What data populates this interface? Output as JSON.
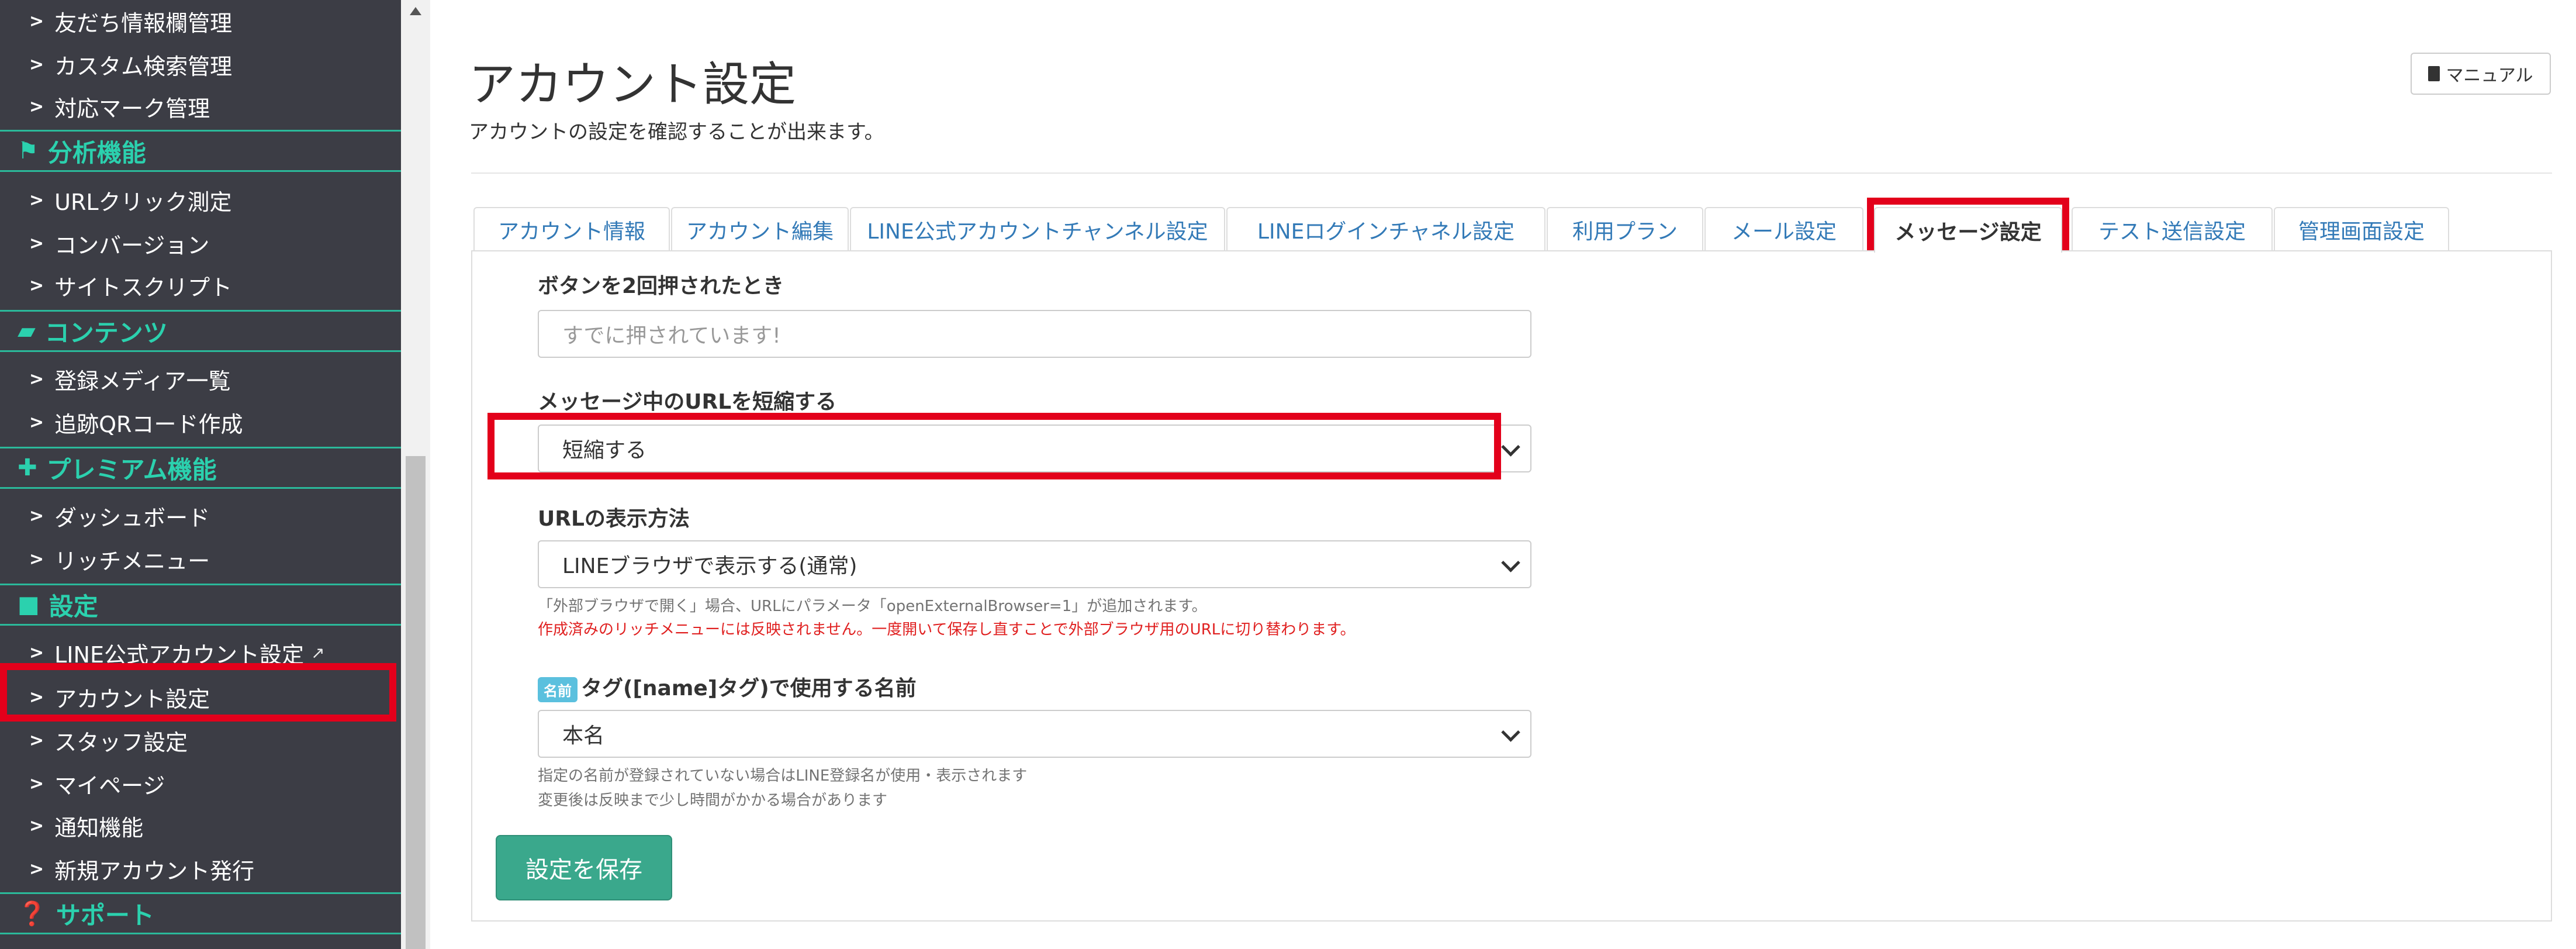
{
  "sidebar": {
    "items_top": [
      {
        "label": "友だち情報欄管理"
      },
      {
        "label": "カスタム検索管理"
      },
      {
        "label": "対応マーク管理"
      }
    ],
    "sections": [
      {
        "title": "分析機能",
        "icon": "flag-icon",
        "items": [
          {
            "label": "URLクリック測定"
          },
          {
            "label": "コンバージョン"
          },
          {
            "label": "サイトスクリプト"
          }
        ]
      },
      {
        "title": "コンテンツ",
        "icon": "folder-icon",
        "items": [
          {
            "label": "登録メディア一覧"
          },
          {
            "label": "追跡QRコード作成"
          }
        ]
      },
      {
        "title": "プレミアム機能",
        "icon": "gift-icon",
        "items": [
          {
            "label": "ダッシュボード"
          },
          {
            "label": "リッチメニュー"
          }
        ]
      },
      {
        "title": "設定",
        "icon": "comment-icon",
        "items": [
          {
            "label": "LINE公式アカウント設定"
          },
          {
            "label": "アカウント設定"
          },
          {
            "label": "スタッフ設定"
          },
          {
            "label": "マイページ"
          },
          {
            "label": "通知機能"
          },
          {
            "label": "新規アカウント発行"
          }
        ]
      },
      {
        "title": "サポート",
        "icon": "question-icon",
        "items": []
      }
    ]
  },
  "header": {
    "title": "アカウント設定",
    "description": "アカウントの設定を確認することが出来ます。",
    "manual_label": "マニュアル"
  },
  "tabs": [
    {
      "label": "アカウント情報"
    },
    {
      "label": "アカウント編集"
    },
    {
      "label": "LINE公式アカウントチャンネル設定"
    },
    {
      "label": "LINEログインチャネル設定"
    },
    {
      "label": "利用プラン"
    },
    {
      "label": "メール設定"
    },
    {
      "label": "メッセージ設定",
      "active": true
    },
    {
      "label": "テスト送信設定"
    },
    {
      "label": "管理画面設定"
    }
  ],
  "form": {
    "double_click": {
      "label": "ボタンを2回押されたとき",
      "placeholder": "すでに押されています!"
    },
    "shorten_url": {
      "label": "メッセージ中のURLを短縮する",
      "value": "短縮する"
    },
    "url_display": {
      "label": "URLの表示方法",
      "value": "LINEブラウザで表示する(通常)",
      "help": "「外部ブラウザで開く」場合、URLにパラメータ「openExternalBrowser=1」が追加されます。",
      "warning": "作成済みのリッチメニューには反映されません。一度開いて保存し直すことで外部ブラウザ用のURLに切り替わります。"
    },
    "name_tag": {
      "badge": "名前",
      "label": "タグ([name]タグ)で使用する名前",
      "value": "本名",
      "help1": "指定の名前が登録されていない場合はLINE登録名が使用・表示されます",
      "help2": "変更後は反映まで少し時間がかかる場合があります"
    },
    "save_label": "設定を保存"
  },
  "colors": {
    "sidebar_bg": "#3c3d45",
    "sidebar_accent": "#2bd1ae",
    "highlight_red": "#e3001b",
    "save_button": "#3aa88c",
    "tab_link": "#337ab7"
  }
}
